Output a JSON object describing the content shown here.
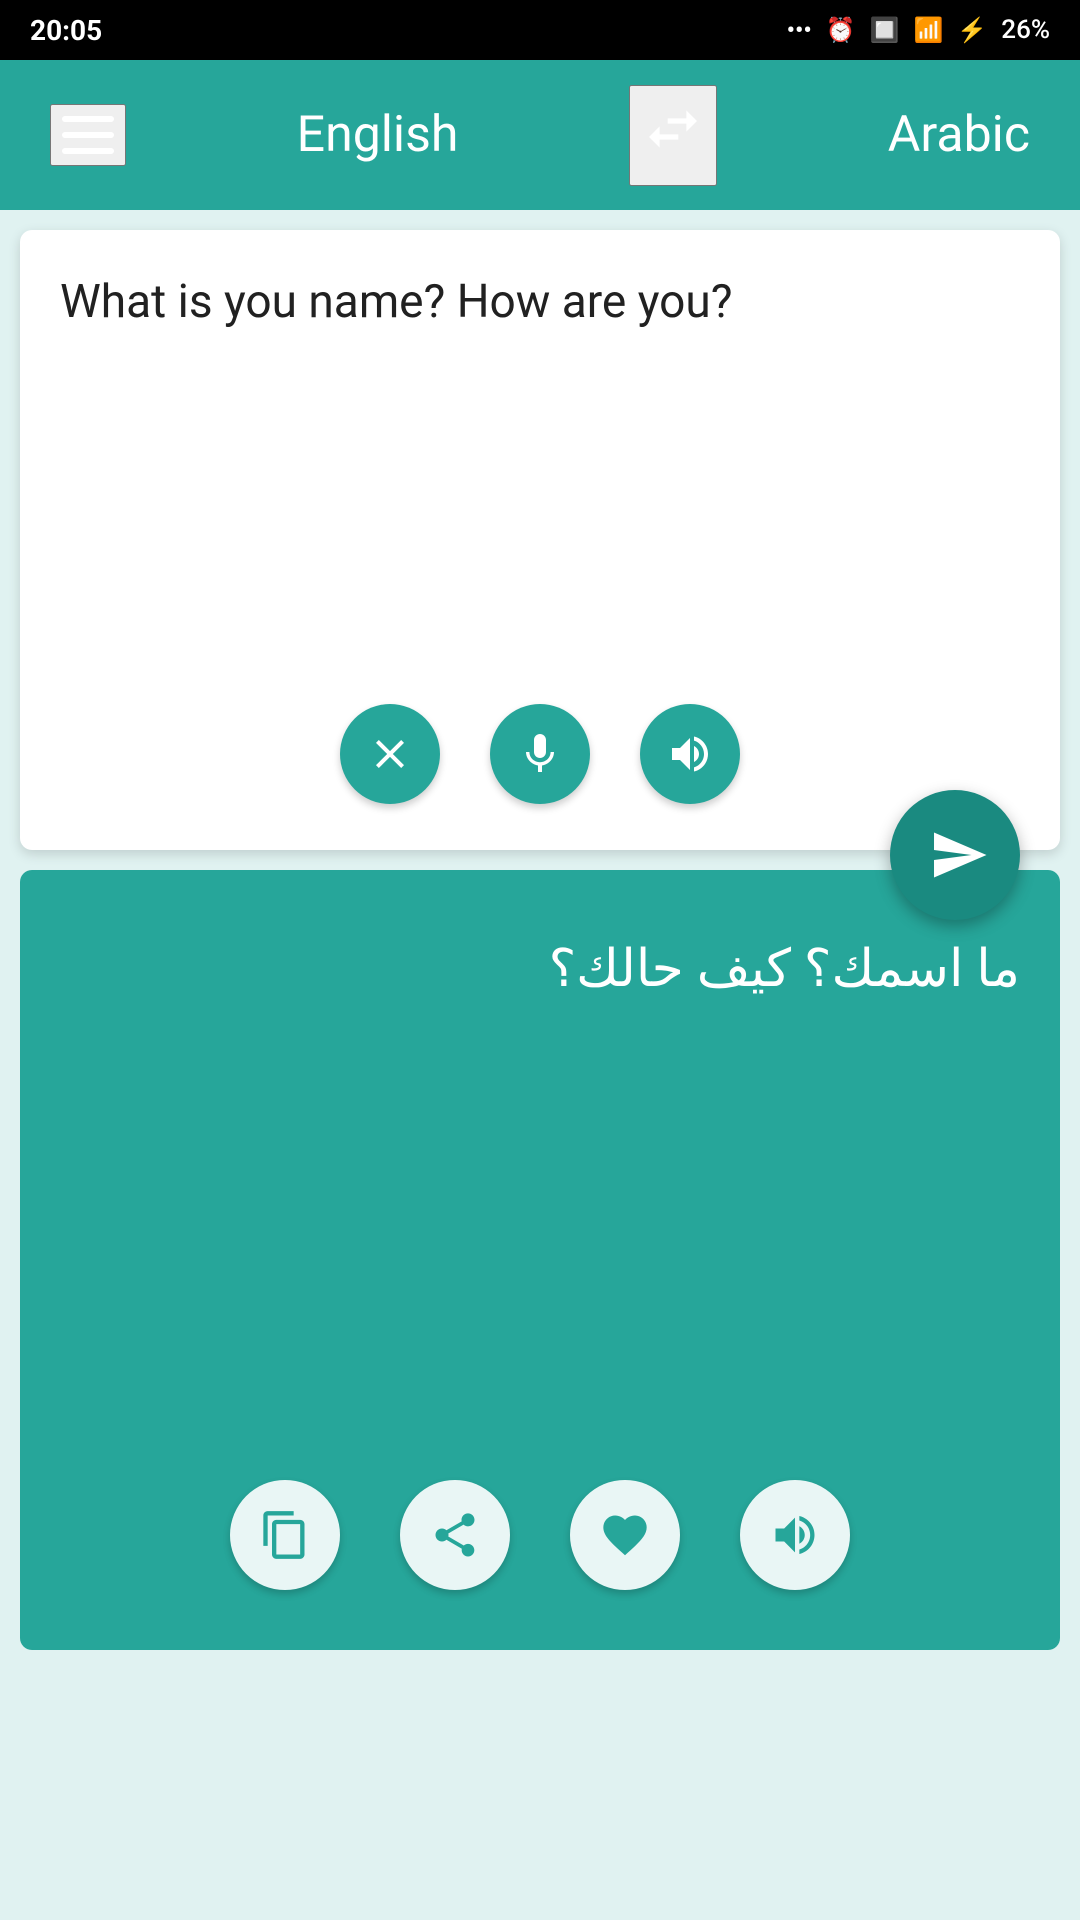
{
  "status_bar": {
    "time": "20:05",
    "battery_percent": "26%"
  },
  "top_nav": {
    "source_language": "English",
    "target_language": "Arabic",
    "swap_tooltip": "Swap languages"
  },
  "input_panel": {
    "input_text": "What is you name? How are you?",
    "clear_button_label": "Clear",
    "mic_button_label": "Microphone",
    "speak_button_label": "Speak input",
    "send_button_label": "Translate"
  },
  "translation_panel": {
    "translated_text": "ما اسمك؟ كيف حالك؟",
    "copy_button_label": "Copy",
    "share_button_label": "Share",
    "favorite_button_label": "Favorite",
    "speak_button_label": "Speak translation"
  }
}
